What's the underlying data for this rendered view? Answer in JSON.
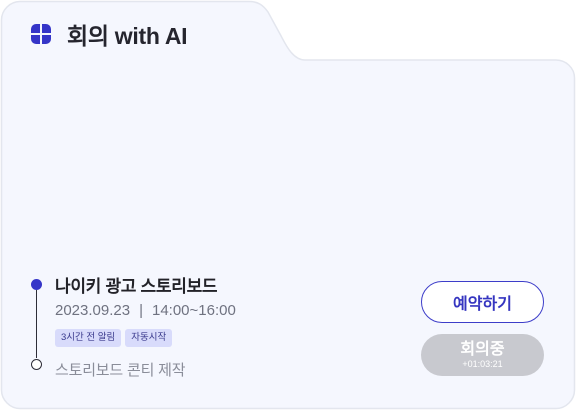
{
  "colors": {
    "card_bg": "#f5f7fe",
    "card_border": "#e3e6ee",
    "accent": "#3535c8",
    "tag_bg": "#d8dbfb",
    "disabled_button": "#c8c9cf"
  },
  "header": {
    "icon": "clover-grid-icon",
    "title": "회의 with AI"
  },
  "current_event": {
    "title": "나이키 광고 스토리보드",
    "date": "2023.09.23",
    "separator": "|",
    "time": "14:00~16:00",
    "tags": [
      "3시간 전 알림",
      "자동시작"
    ]
  },
  "next_event": {
    "title": "스토리보드 콘티 제작"
  },
  "buttons": {
    "reserve_label": "예약하기",
    "meeting_label": "회의중",
    "meeting_timer": "+01:03:21"
  }
}
